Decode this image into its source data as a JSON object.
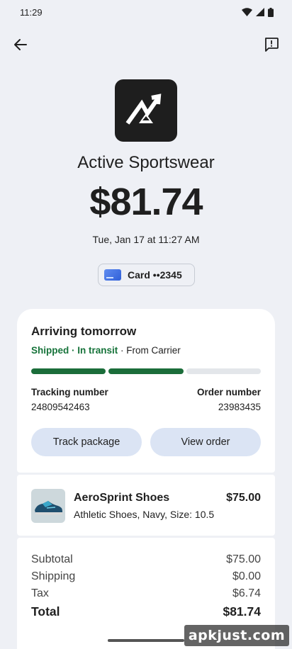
{
  "status": {
    "time": "11:29"
  },
  "merchant": {
    "name": "Active Sportswear"
  },
  "transaction": {
    "amount": "$81.74",
    "datetime": "Tue, Jan 17 at 11:27 AM"
  },
  "payment": {
    "card_label": "Card ••2345"
  },
  "shipping": {
    "title": "Arriving tomorrow",
    "status_shipped": "Shipped",
    "status_transit": "In transit",
    "status_carrier": "From Carrier",
    "progress_done_segments": 2,
    "progress_total_segments": 3,
    "tracking_label": "Tracking number",
    "tracking_value": "24809542463",
    "order_label": "Order number",
    "order_value": "23983435",
    "track_button": "Track package",
    "view_button": "View order"
  },
  "item": {
    "name": "AeroSprint Shoes",
    "description": "Athletic Shoes, Navy, Size: 10.5",
    "price": "$75.00"
  },
  "totals": {
    "subtotal_label": "Subtotal",
    "subtotal_value": "$75.00",
    "shipping_label": "Shipping",
    "shipping_value": "$0.00",
    "tax_label": "Tax",
    "tax_value": "$6.74",
    "total_label": "Total",
    "total_value": "$81.74"
  },
  "watermark": "apkjust.com",
  "icons": {
    "back": "arrow-back-icon",
    "feedback": "feedback-icon",
    "wifi": "wifi-icon",
    "signal": "signal-icon",
    "battery": "battery-icon",
    "card": "card-icon"
  },
  "colors": {
    "accent_green": "#1b6d3a",
    "button_bg": "#dbe4f4",
    "background": "#eef0f5"
  }
}
